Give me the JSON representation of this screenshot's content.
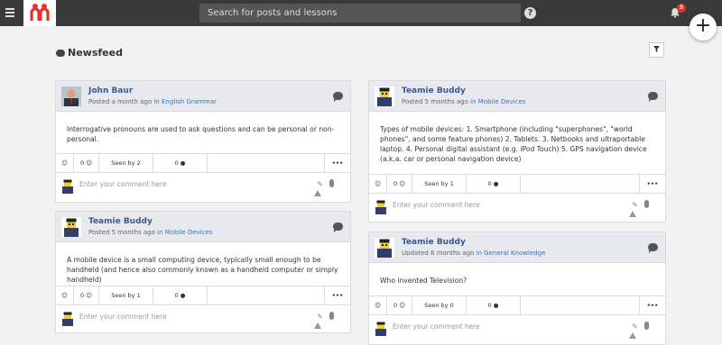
{
  "topbar": {
    "search_placeholder": "Search for posts and lessons",
    "help_label": "?",
    "notification_count": "5",
    "fab_label": "+"
  },
  "page": {
    "title": "Newsfeed"
  },
  "posts": [
    {
      "author": "John Baur",
      "meta_prefix": "Posted a month ago",
      "meta_in": "in",
      "topic": "English Grammar",
      "body": "Interrogative pronouns are used to ask questions and can be personal or non-personal.",
      "likes": "0",
      "seen": "Seen by 2",
      "comments": "0",
      "more": "•••",
      "comment_placeholder": "Enter your comment here"
    },
    {
      "author": "Teamie Buddy",
      "meta_prefix": "Posted 5 months ago",
      "meta_in": "in",
      "topic": "Mobile Devices",
      "body": "A mobile device is a small computing device, typically small enough to be handheld (and hence also commonly known as a handheld computer or simply handheld)",
      "likes": "0",
      "seen": "Seen by 1",
      "comments": "0",
      "more": "•••",
      "comment_placeholder": "Enter your comment here"
    },
    {
      "author": "Teamie Buddy",
      "meta_prefix": "Posted 5 months ago",
      "meta_in": "in",
      "topic": "Mobile Devices",
      "body": "Types of mobile devices: 1. Smartphone (including \"superphones\", \"world phones\", and some feature phones) 2. Tablets. 3. Netbooks and ultraportable laptop. 4. Personal digital assistant (e.g. iPod Touch) 5. GPS navigation device (a.k.a. car or personal navigation device)",
      "likes": "0",
      "seen": "Seen by 1",
      "comments": "0",
      "more": "•••",
      "comment_placeholder": "Enter your comment here"
    },
    {
      "author": "Teamie Buddy",
      "meta_prefix": "Updated 6 months ago",
      "meta_in": "in",
      "topic": "General Knowledge",
      "body": "Who invented Television?",
      "likes": "0",
      "seen": "Seen by 0",
      "comments": "0",
      "more": "•••",
      "comment_placeholder": "Enter your comment here"
    }
  ],
  "icons": {
    "menu": "menu-icon",
    "logo": "brand-logo",
    "help": "help-icon",
    "notifications": "bell-icon",
    "compose": "plus-icon",
    "filter": "filter-icon",
    "comment": "comment-bubble-icon",
    "emoji": "smiley-icon",
    "attach": "paperclip-icon",
    "mic": "microphone-icon",
    "drive": "google-drive-icon"
  },
  "colors": {
    "topbar": "#3a3a3a",
    "brand_red": "#e2332c",
    "link_blue": "#3c72b4",
    "card_header": "#e8e9ee"
  }
}
